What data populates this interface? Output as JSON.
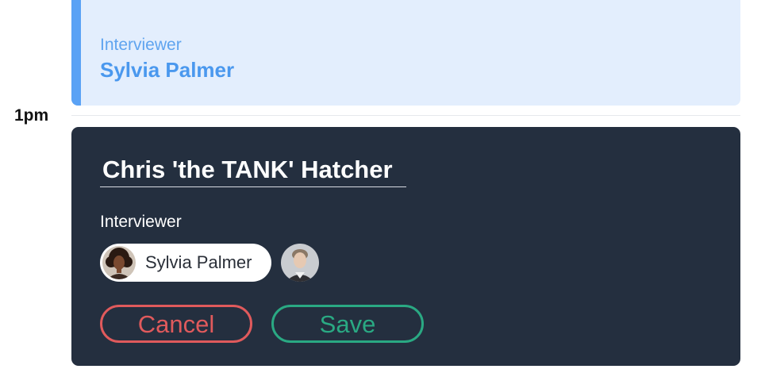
{
  "existing_event": {
    "label": "Interviewer",
    "interviewer": "Sylvia Palmer",
    "accent_color": "#5aa2f5"
  },
  "timeline": {
    "hour_label": "1pm"
  },
  "editor": {
    "title_value": "Chris 'the TANK' Hatcher",
    "interviewer_label": "Interviewer",
    "selected_interviewer": {
      "name": "Sylvia Palmer",
      "avatar_icon": "woman-portrait-avatar"
    },
    "other_interviewers": [
      {
        "avatar_icon": "man-portrait-avatar"
      }
    ],
    "cancel_label": "Cancel",
    "save_label": "Save",
    "colors": {
      "background": "#242f3f",
      "cancel": "#e05a5c",
      "save": "#2aa983"
    }
  }
}
